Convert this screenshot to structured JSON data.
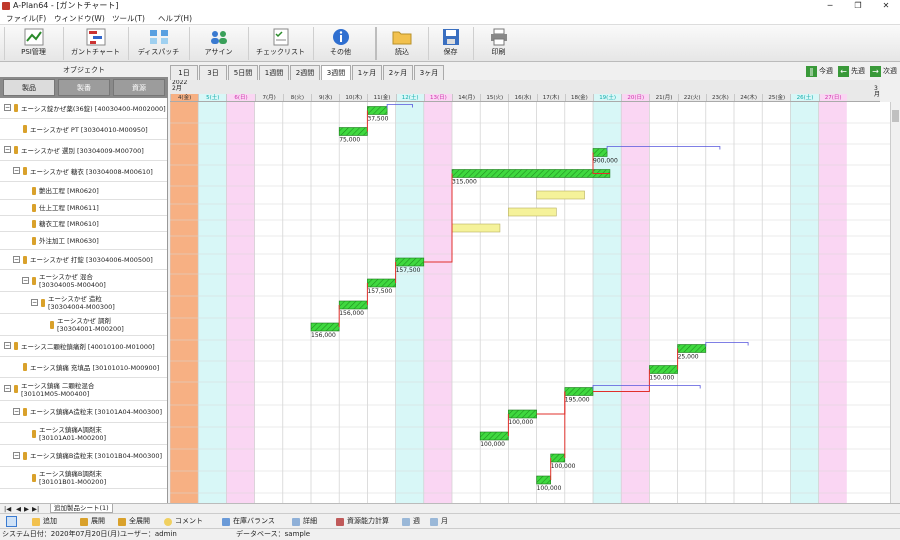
{
  "window": {
    "title": "A-Plan64 - [ガントチャート]"
  },
  "menu": [
    "ファイル(F)",
    "ウィンドウ(W)",
    "ツール(T)",
    "ヘルプ(H)"
  ],
  "toolbar": [
    {
      "label": "PSI管理",
      "icon": "psi-chart-icon"
    },
    {
      "label": "ガントチャート",
      "icon": "gantt-icon"
    },
    {
      "label": "ディスパッチ",
      "icon": "dispatch-icon"
    },
    {
      "label": "アサイン",
      "icon": "assign-users-icon"
    },
    {
      "label": "チェックリスト",
      "icon": "checklist-icon"
    },
    {
      "label": "その他",
      "icon": "info-icon"
    },
    {
      "label": "読込",
      "icon": "folder-open-icon"
    },
    {
      "label": "保存",
      "icon": "save-icon"
    },
    {
      "label": "印刷",
      "icon": "print-icon"
    }
  ],
  "object_panel": {
    "header": "オブジェクト",
    "tabs": [
      "製品",
      "製番",
      "資源"
    ]
  },
  "range_tabs": [
    "1日",
    "3日",
    "5日間",
    "1週間",
    "2週間",
    "3週間",
    "1ヶ月",
    "2ヶ月",
    "3ヶ月"
  ],
  "selected_range": "3週間",
  "nav": {
    "today": "今週",
    "prev": "先週",
    "next": "次週"
  },
  "dates": {
    "year_label": "2022",
    "month_label": "2月",
    "end_month_label": "3月",
    "days": [
      "4(金)",
      "5(土)",
      "6(日)",
      "7(月)",
      "8(火)",
      "9(水)",
      "10(木)",
      "11(金)",
      "12(土)",
      "13(日)",
      "14(月)",
      "15(火)",
      "16(水)",
      "17(木)",
      "18(金)",
      "19(土)",
      "20(日)",
      "21(月)",
      "22(火)",
      "23(水)",
      "24(木)",
      "25(金)",
      "26(土)",
      "27(日)"
    ]
  },
  "tree": [
    {
      "label": "エーシス錠かぜ薬(36錠) [40030400-M002000]",
      "level": 0
    },
    {
      "label": "エーシスかぜ PT [30304010-M00950]",
      "level": 1
    },
    {
      "label": "エーシスかぜ 選別 [30304009-M00700]",
      "level": 0
    },
    {
      "label": "エーシスかぜ 糖衣 [30304008-M00610]",
      "level": 1
    },
    {
      "label": "艶出工程 [MR0620]",
      "level": 2
    },
    {
      "label": "仕上工程 [MR0611]",
      "level": 2
    },
    {
      "label": "糖衣工程 [MR0610]",
      "level": 2
    },
    {
      "label": "外注加工 [MR0630]",
      "level": 2
    },
    {
      "label": "エーシスかぜ 打錠 [30304006-M00500]",
      "level": 1
    },
    {
      "label": "エーシスかぜ 混合",
      "label2": "[30304005-M00400]",
      "level": 2
    },
    {
      "label": "エーシスかぜ 造粒",
      "label2": "[30304004-M00300]",
      "level": 3
    },
    {
      "label": "エーシスかぜ 調剤",
      "label2": "[30304001-M00200]",
      "level": 4
    },
    {
      "label": "エーシス二顆粒鎮痛剤 [40010100-M01000]",
      "level": 0
    },
    {
      "label": "エーシス鎮痛 充填品 [30101010-M00900]",
      "level": 1
    },
    {
      "label": "エーシス鎮痛 二顆粒混合",
      "label2": "[30101M05-M00400]",
      "level": 0
    },
    {
      "label": "エーシス鎮痛A造粒末 [30101A04-M00300]",
      "level": 1
    },
    {
      "label": "エーシス鎮痛A調剤末",
      "label2": "[30101A01-M00200]",
      "level": 2
    },
    {
      "label": "エーシス鎮痛B造粒末 [30101B04-M00300]",
      "level": 1
    },
    {
      "label": "エーシス鎮痛B調剤末",
      "label2": "[30101B01-M00200]",
      "level": 2
    }
  ],
  "bars": [
    {
      "row": 0,
      "start": 7,
      "len": 0.7,
      "qty": "37,500"
    },
    {
      "row": 1,
      "start": 6,
      "len": 1.0,
      "qty": "75,000"
    },
    {
      "row": 2,
      "start": 15,
      "len": 0.5,
      "qty": "900,000"
    },
    {
      "row": 3,
      "start": 10,
      "len": 5.6,
      "qty": "315,000"
    },
    {
      "row": 8,
      "start": 8,
      "len": 1.0,
      "qty": "157,500"
    },
    {
      "row": 9,
      "start": 7,
      "len": 1.0,
      "qty": "157,500"
    },
    {
      "row": 10,
      "start": 6,
      "len": 1.0,
      "qty": "156,000"
    },
    {
      "row": 11,
      "start": 5,
      "len": 1.0,
      "qty": "156,000"
    },
    {
      "row": 12,
      "start": 18,
      "len": 1.0,
      "qty": "25,000"
    },
    {
      "row": 13,
      "start": 17,
      "len": 1.0,
      "qty": "150,000"
    },
    {
      "row": 14,
      "start": 14,
      "len": 1.0,
      "qty": "195,000"
    },
    {
      "row": 15,
      "start": 12,
      "len": 1.0,
      "qty": "100,000"
    },
    {
      "row": 16,
      "start": 11,
      "len": 1.0,
      "qty": "100,000"
    },
    {
      "row": 17,
      "start": 13.5,
      "len": 0.5,
      "qty": "100,000"
    },
    {
      "row": 18,
      "start": 13,
      "len": 0.5,
      "qty": "100,000"
    }
  ],
  "resource_bars": [
    {
      "row": 4,
      "start": 13,
      "len": 1.7
    },
    {
      "row": 5,
      "start": 12,
      "len": 1.7
    },
    {
      "row": 6,
      "start": 10,
      "len": 1.7
    }
  ],
  "sheet_tab": "追加製品シート(1)",
  "bottom_buttons": [
    "追加",
    "展開",
    "全展開",
    "コメント",
    "在庫バランス",
    "詳細",
    "資源能力計算",
    "週",
    "月"
  ],
  "status": {
    "date": "システム日付：2020年07月20日(月)",
    "user": "ユーザー：admin",
    "db": "データベース：sample"
  },
  "colors": {
    "saturday": "#d8f7f7",
    "sunday": "#fad6f3",
    "holiday": "#f7b083",
    "bar": "#3fd93f",
    "resource_bar": "#f5f29a",
    "link": "#e0302b"
  }
}
